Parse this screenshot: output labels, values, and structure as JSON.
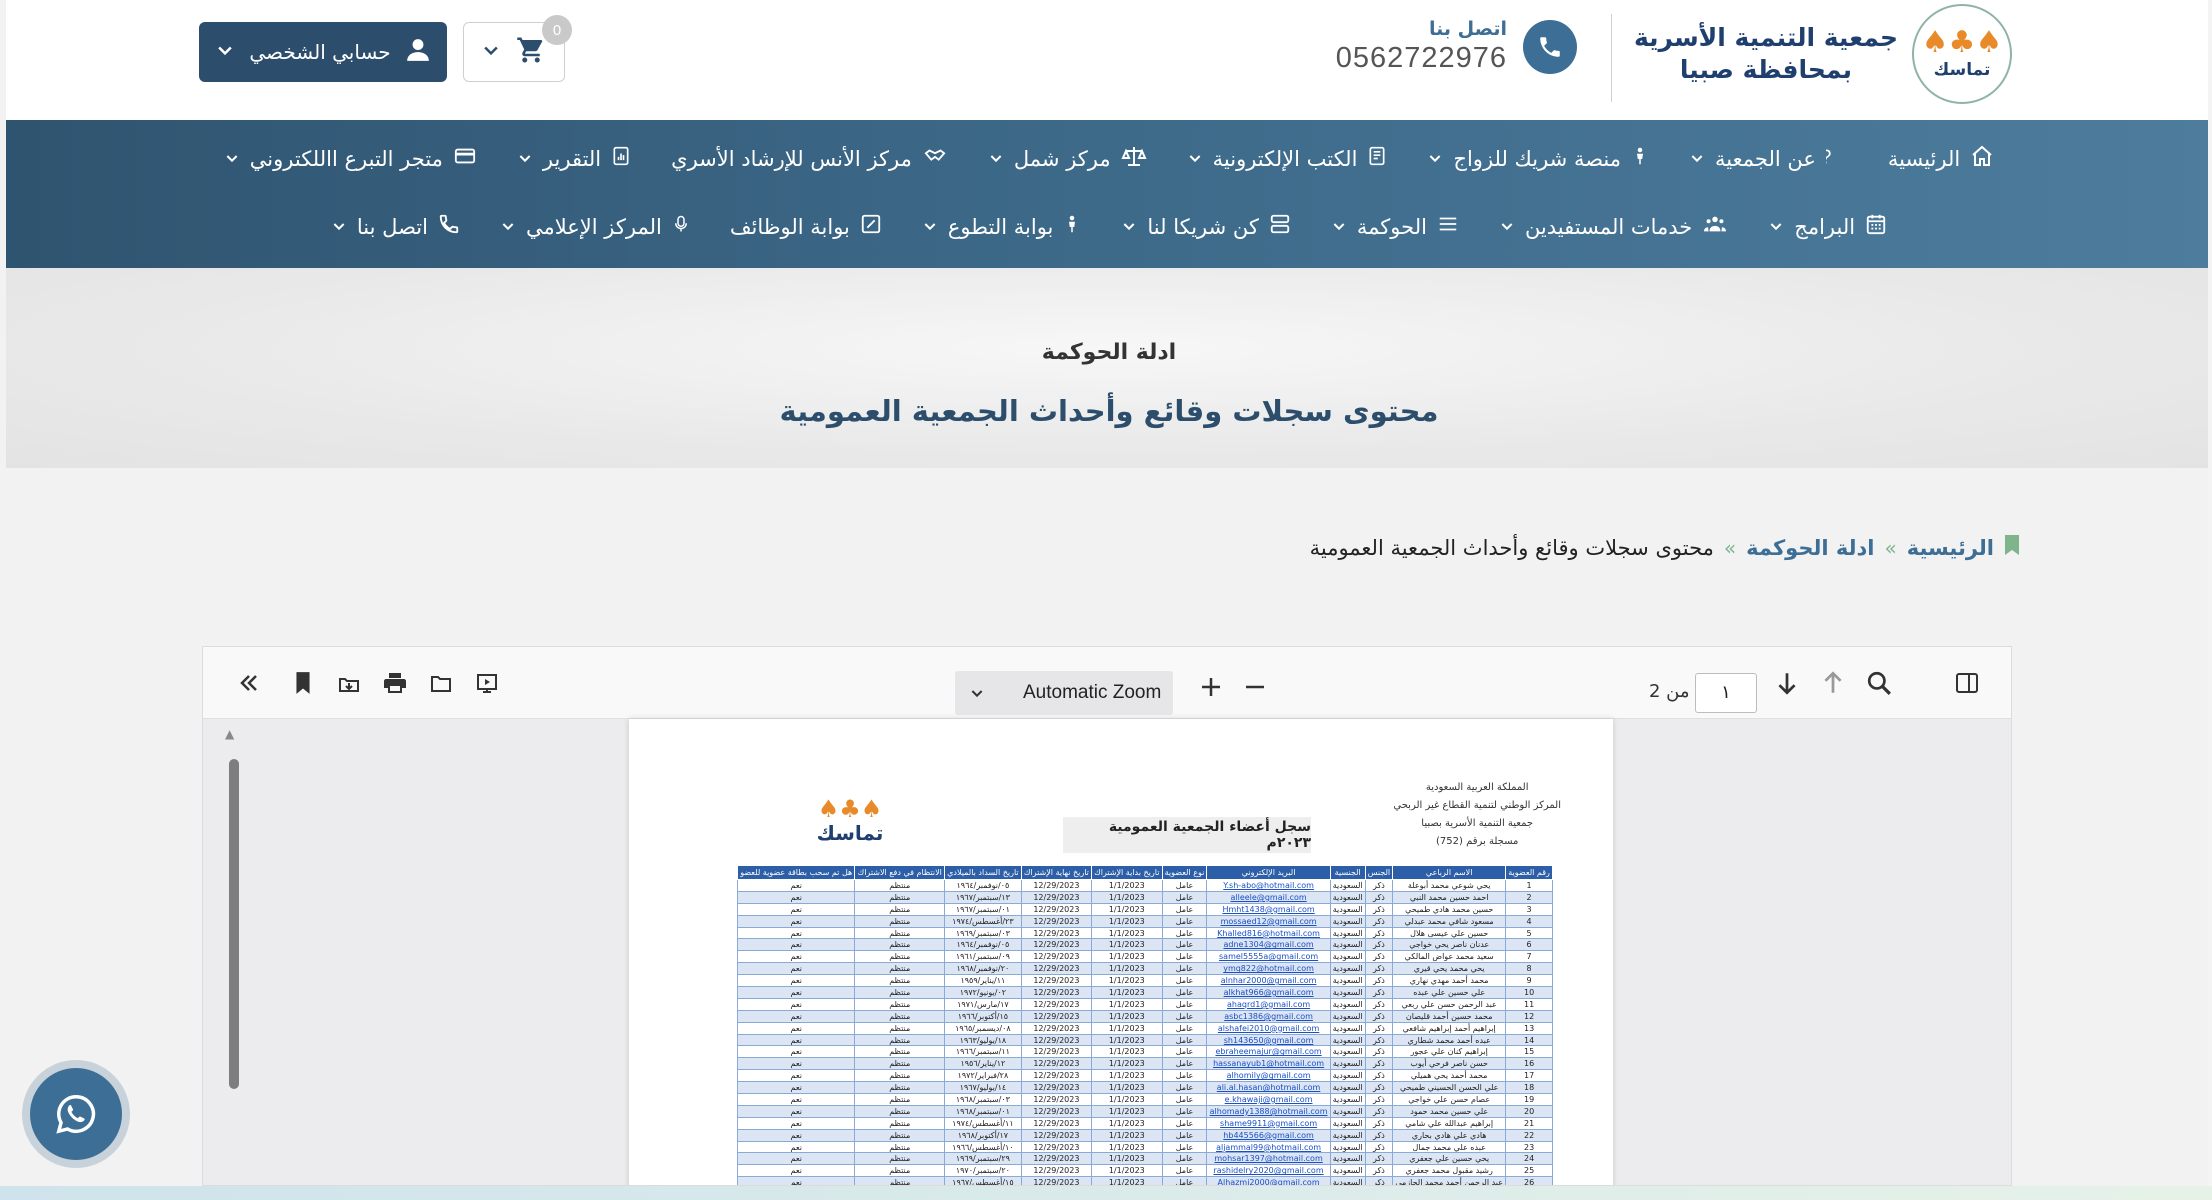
{
  "header": {
    "brand_line1": "جمعية التنمية الأسرية",
    "brand_line2": "بمحافظة صبيا",
    "logo_text": "تماسك",
    "contact_label": "اتصل بنا",
    "contact_number": "0562722976",
    "account_label": "حسابي الشخصي",
    "cart_count": "0"
  },
  "nav": {
    "row1": [
      {
        "label": "الرئيسية",
        "icon": "home-icon"
      },
      {
        "label": "عن الجمعية",
        "icon": "question-icon"
      },
      {
        "label": "منصة شريك للزواج",
        "icon": "person-icon"
      },
      {
        "label": "الكتب الإلكترونية",
        "icon": "book-icon"
      },
      {
        "label": "مركز شمل",
        "icon": "balance-icon"
      },
      {
        "label": "مركز الأنس للإرشاد الأسري",
        "icon": "handshake-icon"
      },
      {
        "label": "التقرير",
        "icon": "report-icon"
      },
      {
        "label": "متجر التبرع االلكتروني",
        "icon": "card-icon"
      }
    ],
    "row2": [
      {
        "label": "البرامج",
        "icon": "calendar-icon"
      },
      {
        "label": "خدمات المستفيدين",
        "icon": "users-icon"
      },
      {
        "label": "الحوكمة",
        "icon": "list-icon"
      },
      {
        "label": "كن شريكا لنا",
        "icon": "server-icon"
      },
      {
        "label": "بوابة التطوع",
        "icon": "person-icon"
      },
      {
        "label": "بوابة الوظائف",
        "icon": "edit-icon"
      },
      {
        "label": "المركز الإعلامي",
        "icon": "mic-icon"
      },
      {
        "label": "اتصل بنا",
        "icon": "phone-icon"
      }
    ]
  },
  "hero": {
    "subtitle": "ادلة الحوكمة",
    "title": "محتوى سجلات وقائع وأحداث الجمعية العمومية"
  },
  "breadcrumb": {
    "home": "الرئيسية",
    "section": "ادلة الحوكمة",
    "current": "محتوى سجلات وقائع وأحداث الجمعية العمومية",
    "sep": "»"
  },
  "viewer": {
    "zoom_label": "Automatic Zoom",
    "page_current": "١",
    "page_of": "من 2"
  },
  "document": {
    "org_line1": "المملكة العربية السعودية",
    "org_line2": "المركز الوطني لتنمية القطاع غير الربحي",
    "org_line3": "جمعية التنمية الأسرية بصبيا",
    "org_line4": "مسجلة برقم (752)",
    "title": "سجل أعضاء الجمعية العمومية ٢٠٢٣م",
    "logo_text": "تماسك",
    "columns": [
      "رقم العضوية",
      "الاسم الرباعي",
      "الجنس",
      "الجنسية",
      "البريد الإلكتروني",
      "نوع العضوية",
      "تاريخ بداية الإشتراك",
      "تاريخ نهاية الإشتراك",
      "تاريخ السداد بالميلادي",
      "الانتظام في دفع الاشتراك",
      "هل تم سحب بطاقة عضوية للعضو"
    ],
    "rows": [
      [
        "1",
        "يحي شوعي محمد أبوعلة",
        "ذكر",
        "السعودية",
        "Y.sh-abo@hotmail.com",
        "عامل",
        "1/1/2023",
        "12/29/2023",
        "٠٥/نوفمبر/١٩٦٤",
        "منتظم",
        "نعم"
      ],
      [
        "2",
        "احمد حسين محمد النبي",
        "ذكر",
        "السعودية",
        "alleele@gmail.com",
        "عامل",
        "1/1/2023",
        "12/29/2023",
        "١٣/سبتمبر/١٩٦٧",
        "منتظم",
        "نعم"
      ],
      [
        "3",
        "حسين محمد هادي طميحي",
        "ذكر",
        "السعودية",
        "Hmht1438@gmail.com",
        "عامل",
        "1/1/2023",
        "12/29/2023",
        "٠١/سبتمبر/١٩٦٧",
        "منتظم",
        "نعم"
      ],
      [
        "4",
        "مسعود شافي محمد عبدلي",
        "ذكر",
        "السعودية",
        "mossaed12@gmail.com",
        "عامل",
        "1/1/2023",
        "12/29/2023",
        "٢٣/أغسطس/١٩٧٤",
        "منتظم",
        "نعم"
      ],
      [
        "5",
        "حسين علي عيسى هلال",
        "ذكر",
        "السعودية",
        "Khalled816@hotmail.com",
        "عامل",
        "1/1/2023",
        "12/29/2023",
        "٠٣/سبتمبر/١٩٦٩",
        "منتظم",
        "نعم"
      ],
      [
        "6",
        "عدنان ناصر يحي خواجي",
        "ذكر",
        "السعودية",
        "adne1304@gmail.com",
        "عامل",
        "1/1/2023",
        "12/29/2023",
        "٠٥/نوفمبر/١٩٦٤",
        "منتظم",
        "نعم"
      ],
      [
        "7",
        "سعيد محمد عواض المالكي",
        "ذكر",
        "السعودية",
        "samel5555a@gmail.com",
        "عامل",
        "1/1/2023",
        "12/29/2023",
        "٠٩/سبتمبر/١٩٦١",
        "منتظم",
        "نعم"
      ],
      [
        "8",
        "يحي محمد يحي قيري",
        "ذكر",
        "السعودية",
        "ymq822@hotmail.com",
        "عامل",
        "1/1/2023",
        "12/29/2023",
        "٢٠/نوفمبر/١٩٦٨",
        "منتظم",
        "نعم"
      ],
      [
        "9",
        "محمد أحمد مهدي نهاري",
        "ذكر",
        "السعودية",
        "alnhar2000@gmail.com",
        "عامل",
        "1/1/2023",
        "12/29/2023",
        "١١/يناير/١٩٥٩",
        "منتظم",
        "نعم"
      ],
      [
        "10",
        "علي حسين علي عبده",
        "ذكر",
        "السعودية",
        "alkhat966@gmail.com",
        "عامل",
        "1/1/2023",
        "12/29/2023",
        "٠٢/يونيو/١٩٧٢",
        "منتظم",
        "نعم"
      ],
      [
        "11",
        "عبد الرحمن حسن علي ربعي",
        "ذكر",
        "السعودية",
        "ahaqrd1@gmail.com",
        "عامل",
        "1/1/2023",
        "12/29/2023",
        "١٧/مارس/١٩٧١",
        "منتظم",
        "نعم"
      ],
      [
        "12",
        "محمد حسين أحمد قليصان",
        "ذكر",
        "السعودية",
        "asbc1386@gmail.com",
        "عامل",
        "1/1/2023",
        "12/29/2023",
        "١٥/أكتوبر/١٩٦٦",
        "منتظم",
        "نعم"
      ],
      [
        "13",
        "إبراهيم أحمد إبراهيم شافعي",
        "ذكر",
        "السعودية",
        "alshafei2010@gmail.com",
        "عامل",
        "1/1/2023",
        "12/29/2023",
        "٠٨/ديسمبر/١٩٦٥",
        "منتظم",
        "نعم"
      ],
      [
        "14",
        "عبده أحمد محمد شطاري",
        "ذكر",
        "السعودية",
        "sh143650@gmail.com",
        "عامل",
        "1/1/2023",
        "12/29/2023",
        "١٨/يوليو/١٩٦٣",
        "منتظم",
        "نعم"
      ],
      [
        "15",
        "إبراهيم كنان علي عجور",
        "ذكر",
        "السعودية",
        "ebraheemajur@gmail.com",
        "عامل",
        "1/1/2023",
        "12/29/2023",
        "١١/سبتمبر/١٩٦٦",
        "منتظم",
        "نعم"
      ],
      [
        "16",
        "حسن ناصر فرحي أيوب",
        "ذكر",
        "السعودية",
        "hassanayub1@hotmail.com",
        "عامل",
        "1/1/2023",
        "12/29/2023",
        "١٢/يناير/١٩٥٦",
        "منتظم",
        "نعم"
      ],
      [
        "17",
        "محمد أحمد يحي هميلي",
        "ذكر",
        "السعودية",
        "alhomily@gmail.com",
        "عامل",
        "1/1/2023",
        "12/29/2023",
        "٢٨/فبراير/١٩٧٢",
        "منتظم",
        "نعم"
      ],
      [
        "18",
        "علي الحسن الحسيني طميحي",
        "ذكر",
        "السعودية",
        "ali.al.hasan@hotmail.com",
        "عامل",
        "1/1/2023",
        "12/29/2023",
        "١٤/يوليو/١٩٦٧",
        "منتظم",
        "نعم"
      ],
      [
        "19",
        "عصام حسن علي خواجي",
        "ذكر",
        "السعودية",
        "e.khawaji@gmail.com",
        "عامل",
        "1/1/2023",
        "12/29/2023",
        "٠٣/سبتمبر/١٩٦٨",
        "منتظم",
        "نعم"
      ],
      [
        "20",
        "علي حسين محمد حمود",
        "ذكر",
        "السعودية",
        "alhomady1388@hotmail.com",
        "عامل",
        "1/1/2023",
        "12/29/2023",
        "٠١/سبتمبر/١٩٦٨",
        "منتظم",
        "نعم"
      ],
      [
        "21",
        "إبراهيم عبدالله علي شامي",
        "ذكر",
        "السعودية",
        "shame9911@gmail.com",
        "عامل",
        "1/1/2023",
        "12/29/2023",
        "١١/أغسطس/١٩٧٤",
        "منتظم",
        "نعم"
      ],
      [
        "22",
        "هادي علي هادي بحاري",
        "ذكر",
        "السعودية",
        "hb445566@gmail.com",
        "عامل",
        "1/1/2023",
        "12/29/2023",
        "١٧/أكتوبر/١٩٦٨",
        "منتظم",
        "نعم"
      ],
      [
        "23",
        "عبده علي محمد جمال",
        "ذكر",
        "السعودية",
        "aljammal99@hotmail.com",
        "عامل",
        "1/1/2023",
        "12/29/2023",
        "١٠/أغسطس/١٩٦٦",
        "منتظم",
        "نعم"
      ],
      [
        "24",
        "يحي حسين علي جعفري",
        "ذكر",
        "السعودية",
        "mohsar1397@hotmail.com",
        "عامل",
        "1/1/2023",
        "12/29/2023",
        "٢٩/سبتمبر/١٩٦٩",
        "منتظم",
        "نعم"
      ],
      [
        "25",
        "رشيد مقبول محمد جعفري",
        "ذكر",
        "السعودية",
        "rashidelry2020@gmail.com",
        "عامل",
        "1/1/2023",
        "12/29/2023",
        "٢٠/سبتمبر/١٩٧٠",
        "منتظم",
        "نعم"
      ],
      [
        "26",
        "عبد الرحمن أحمد محمد الحازمي",
        "ذكر",
        "السعودية",
        "Alhazmi2000@gmail.com",
        "عامل",
        "1/1/2023",
        "12/29/2023",
        "١٥/أغسطس/١٩٦٧",
        "منتظم",
        "نعم"
      ]
    ]
  },
  "colors": {
    "brand_dark": "#2c4e6c",
    "nav_blue": "#3e6a8a",
    "accent_green": "#7fb48d",
    "table_header": "#2d5fa8"
  }
}
